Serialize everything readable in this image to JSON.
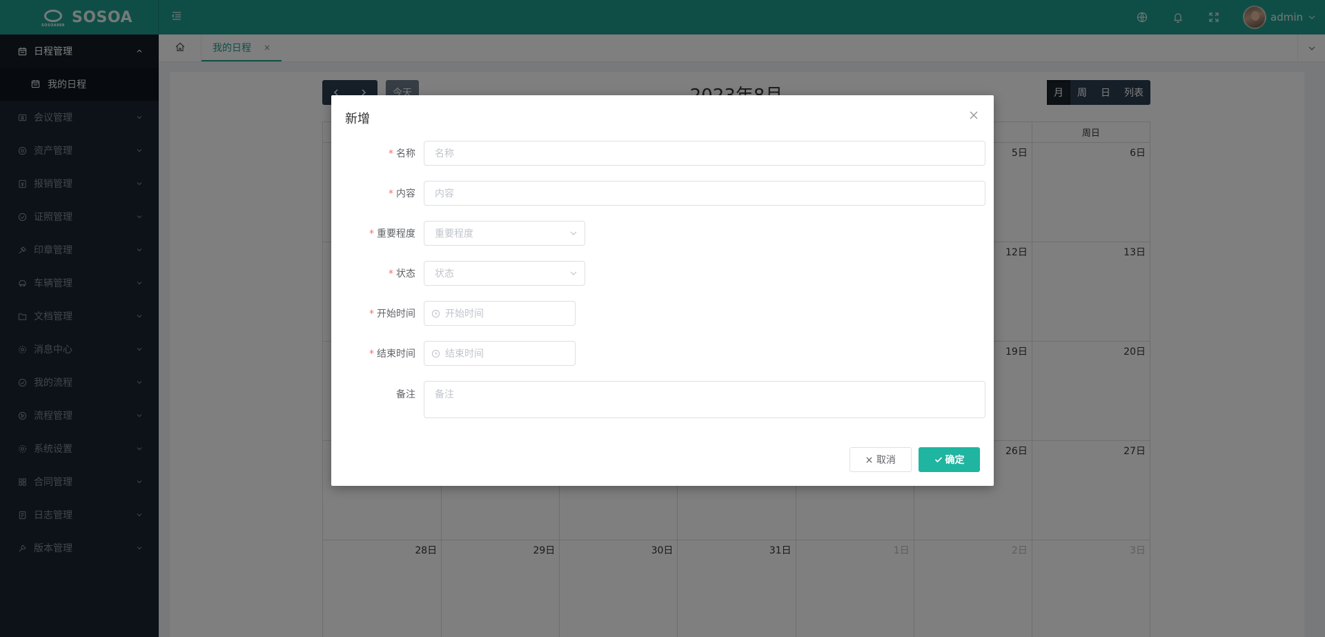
{
  "header": {
    "logo_text": "SOSOA",
    "logo_subtext": "SOSOA888",
    "user_name": "admin"
  },
  "sidebar": {
    "items": [
      {
        "label": "日程管理",
        "icon": "calendar-icon",
        "expanded": true
      },
      {
        "label": "会议管理",
        "icon": "meeting-icon"
      },
      {
        "label": "资产管理",
        "icon": "asset-icon"
      },
      {
        "label": "报销管理",
        "icon": "reimburse-icon"
      },
      {
        "label": "证照管理",
        "icon": "certificate-icon"
      },
      {
        "label": "印章管理",
        "icon": "seal-icon"
      },
      {
        "label": "车辆管理",
        "icon": "car-icon"
      },
      {
        "label": "文档管理",
        "icon": "folder-icon"
      },
      {
        "label": "消息中心",
        "icon": "message-icon"
      },
      {
        "label": "我的流程",
        "icon": "check-circle-icon"
      },
      {
        "label": "流程管理",
        "icon": "play-circle-icon"
      },
      {
        "label": "系统设置",
        "icon": "gear-icon"
      },
      {
        "label": "合同管理",
        "icon": "contract-icon"
      },
      {
        "label": "日志管理",
        "icon": "log-icon"
      },
      {
        "label": "版本管理",
        "icon": "wrench-icon"
      }
    ],
    "sub_item": {
      "label": "我的日程",
      "icon": "calendar-icon"
    }
  },
  "tabs": {
    "items": [
      {
        "label": "我的日程",
        "close": "×"
      }
    ]
  },
  "calendar": {
    "title": "2023年8月",
    "today_label": "今天",
    "views": [
      {
        "label": "月",
        "active": true
      },
      {
        "label": "周",
        "active": false
      },
      {
        "label": "日",
        "active": false
      },
      {
        "label": "列表",
        "active": false
      }
    ],
    "weekday_header_visible": "周日",
    "rows": [
      [
        "",
        "",
        "",
        "",
        "",
        "5日",
        "6日"
      ],
      [
        "",
        "",
        "",
        "",
        "",
        "12日",
        "13日"
      ],
      [
        "",
        "",
        "",
        "",
        "",
        "19日",
        "20日"
      ],
      [
        "",
        "",
        "",
        "",
        "",
        "26日",
        "27日"
      ],
      [
        "28日",
        "29日",
        "30日",
        "31日",
        "1日",
        "2日",
        "3日"
      ]
    ],
    "other_month_cells": [
      "1日",
      "2日",
      "3日"
    ]
  },
  "modal": {
    "title": "新增",
    "fields": {
      "name": {
        "label": "名称",
        "placeholder": "名称",
        "required": true
      },
      "content": {
        "label": "内容",
        "placeholder": "内容",
        "required": true
      },
      "importance": {
        "label": "重要程度",
        "placeholder": "重要程度",
        "required": true
      },
      "status": {
        "label": "状态",
        "placeholder": "状态",
        "required": true
      },
      "start_time": {
        "label": "开始时间",
        "placeholder": "开始时间",
        "required": true
      },
      "end_time": {
        "label": "结束时间",
        "placeholder": "结束时间",
        "required": true
      },
      "remark": {
        "label": "备注",
        "placeholder": "备注",
        "required": false
      }
    },
    "required_mark": "*",
    "cancel_label": "取消",
    "ok_label": "确定"
  },
  "colors": {
    "header": "#1f9d8c",
    "sidebar": "#1a2430",
    "primary_button": "#1fb5a0",
    "required": "#f56c6c",
    "calendar_toolbar": "#2c3e50"
  }
}
